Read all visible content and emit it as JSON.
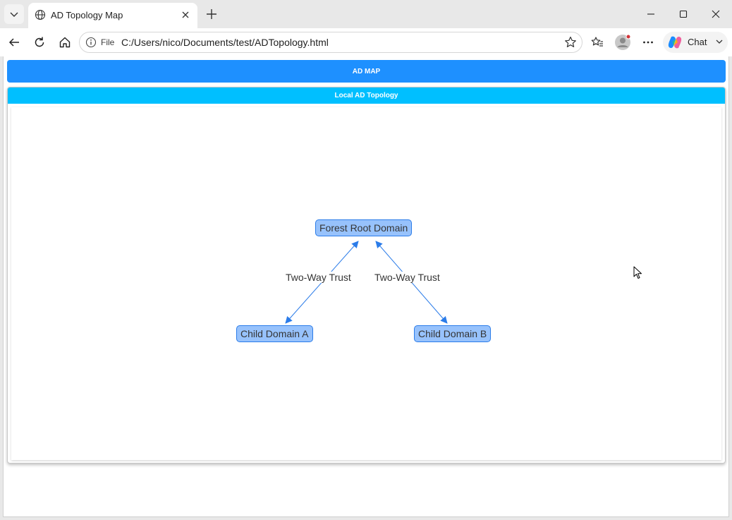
{
  "browser": {
    "tab": {
      "title": "AD Topology Map"
    },
    "address": {
      "scheme_label": "File",
      "url": "C:/Users/nico/Documents/test/ADTopology.html"
    },
    "chat_label": "Chat"
  },
  "page": {
    "header_title": "AD MAP",
    "panel_title": "Local AD Topology",
    "graph": {
      "nodes": [
        {
          "id": "root",
          "label": "Forest Root Domain"
        },
        {
          "id": "a",
          "label": "Child Domain A"
        },
        {
          "id": "b",
          "label": "Child Domain B"
        }
      ],
      "edges": [
        {
          "from": "a",
          "to": "root",
          "label": "Two-Way Trust",
          "arrows": "both"
        },
        {
          "from": "root",
          "to": "b",
          "label": "Two-Way Trust",
          "arrows": "both"
        }
      ],
      "colors": {
        "node_fill": "#97c2fc",
        "node_border": "#2b7ce9",
        "edge": "#2b7ce9"
      }
    }
  },
  "colors": {
    "header_bar": "#1e90ff",
    "panel_title_bar": "#00bfff"
  }
}
